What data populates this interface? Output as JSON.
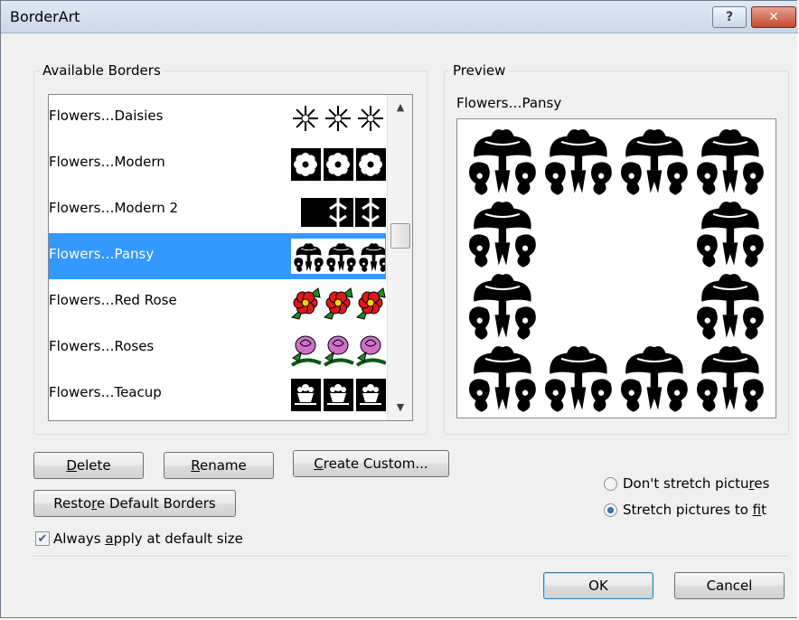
{
  "window": {
    "title": "BorderArt",
    "help_label": "?",
    "close_label": "✕"
  },
  "available_borders": {
    "label": "Available Borders",
    "items": [
      {
        "label": "Flowers…Daisies",
        "selected": false,
        "swatch": "daisies"
      },
      {
        "label": "Flowers…Modern",
        "selected": false,
        "swatch": "modern"
      },
      {
        "label": "Flowers…Modern 2",
        "selected": false,
        "swatch": "modern2"
      },
      {
        "label": "Flowers…Pansy",
        "selected": true,
        "swatch": "pansy"
      },
      {
        "label": "Flowers…Red Rose",
        "selected": false,
        "swatch": "redrose"
      },
      {
        "label": "Flowers…Roses",
        "selected": false,
        "swatch": "roses"
      },
      {
        "label": "Flowers…Teacup",
        "selected": false,
        "swatch": "teacup"
      }
    ]
  },
  "preview": {
    "label": "Preview",
    "name": "Flowers…Pansy"
  },
  "buttons": {
    "delete": "Delete",
    "rename": "Rename",
    "create_custom": "Create Custom...",
    "restore_defaults": "Restore Default Borders",
    "ok": "OK",
    "cancel": "Cancel"
  },
  "options": {
    "always_default_size": {
      "label": "Always apply at default size",
      "checked": true
    },
    "dont_stretch": {
      "label": "Don't stretch pictures",
      "selected": false
    },
    "stretch_to_fit": {
      "label": "Stretch pictures to fit",
      "selected": true
    }
  },
  "colors": {
    "selection": "#3399ff",
    "rose_red": "#e01818",
    "rose_pink": "#d070c8",
    "leaf_green": "#1e8c1e",
    "leaf_dark_green": "#0a5a14"
  },
  "icons": [
    "help-icon",
    "close-icon",
    "scroll-up-icon",
    "scroll-down-icon",
    "checkmark-icon"
  ]
}
